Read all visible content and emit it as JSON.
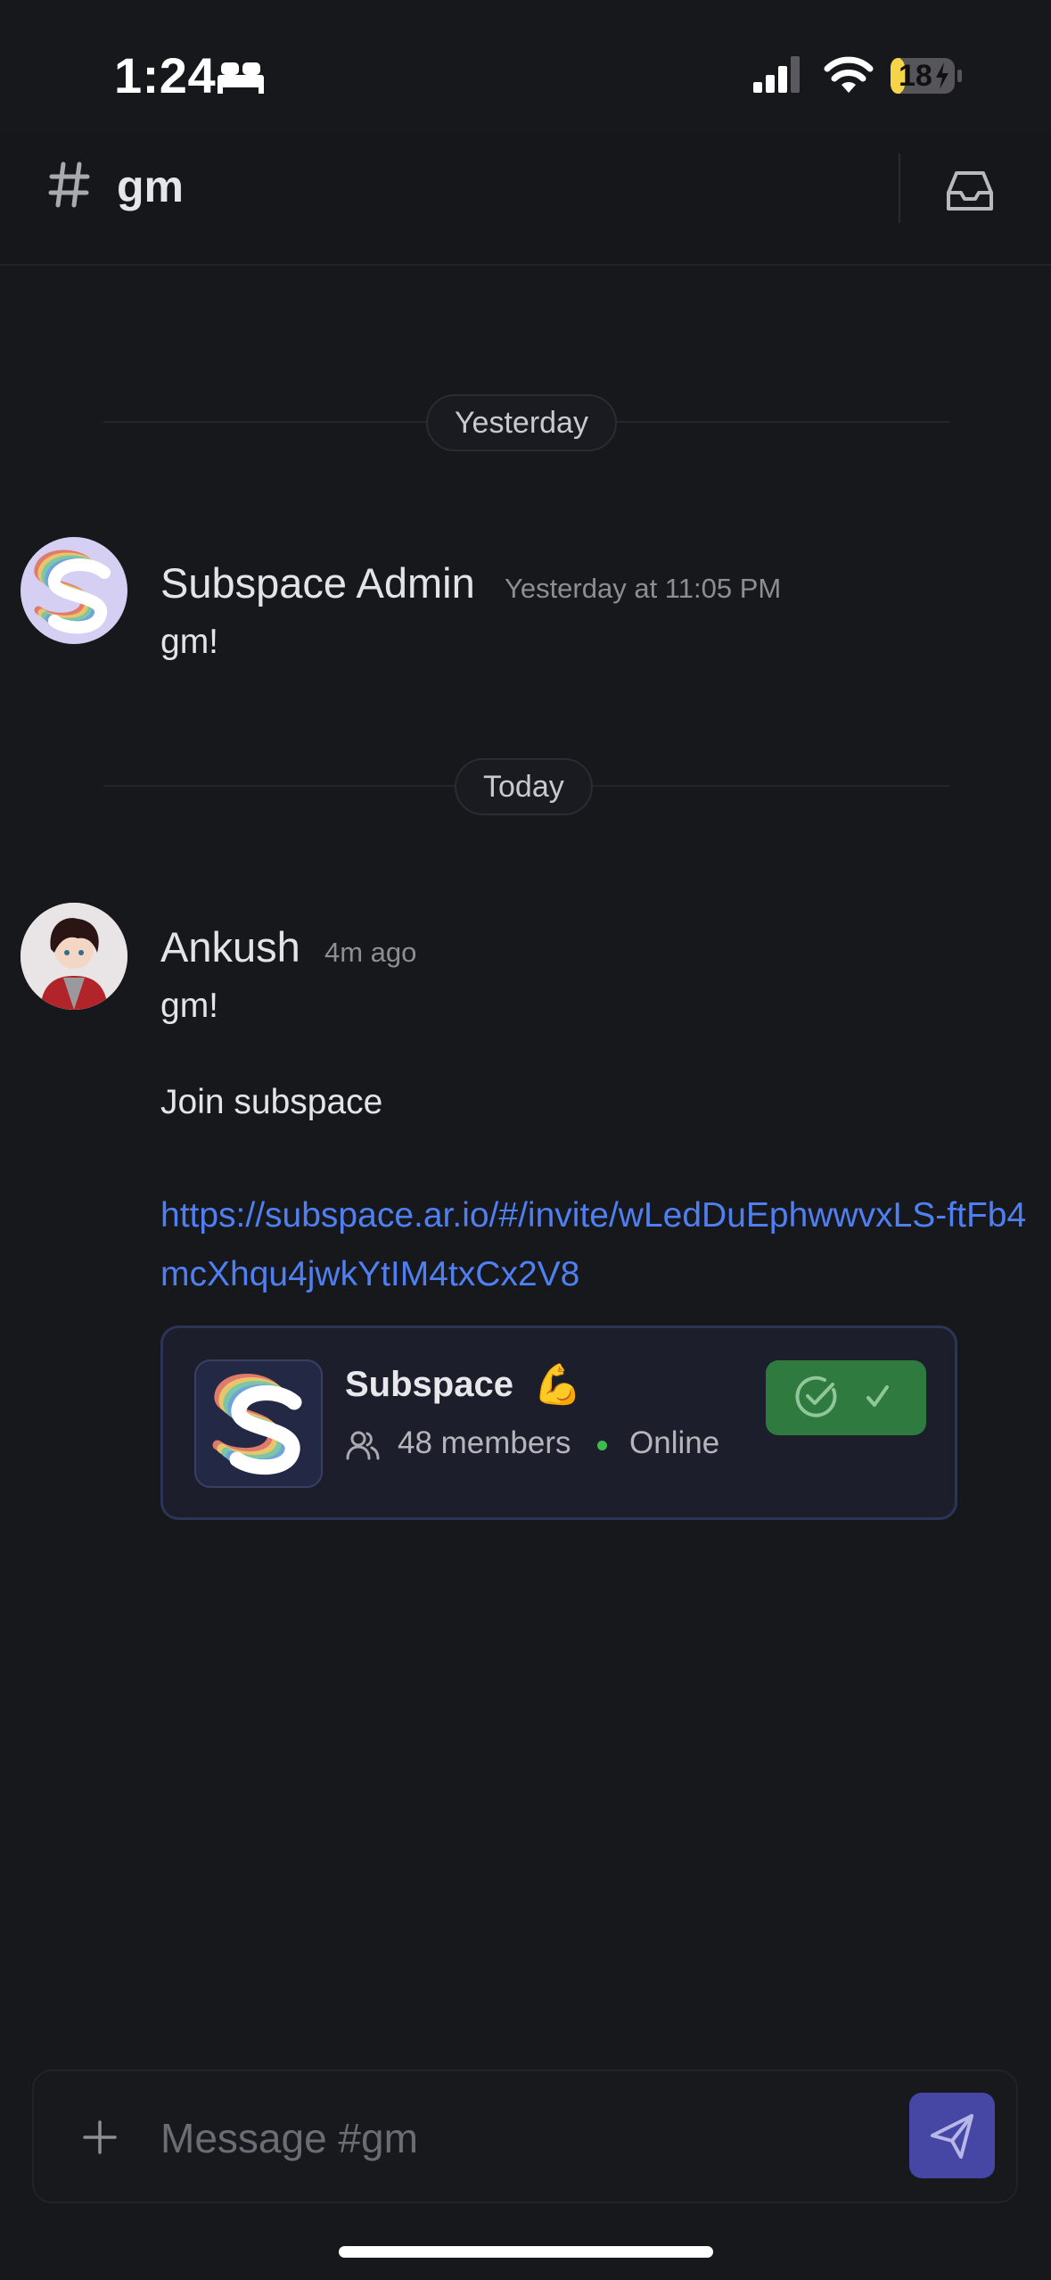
{
  "status_bar": {
    "time": "1:24",
    "battery": "18"
  },
  "channel": {
    "name": "gm"
  },
  "separators": {
    "yesterday": "Yesterday",
    "today": "Today"
  },
  "messages": [
    {
      "author": "Subspace Admin",
      "timestamp": "Yesterday at 11:05 PM",
      "lines": [
        "gm!"
      ]
    },
    {
      "author": "Ankush",
      "timestamp": "4m ago",
      "lines": [
        "gm!",
        "Join subspace"
      ],
      "link": "https://subspace.ar.io/#/invite/wLedDuEphwwvxLS-ftFb4mcXhqu4jwkYtIM4txCx2V8"
    }
  ],
  "invite_card": {
    "server_name": "Subspace",
    "server_emoji": "💪",
    "members": "48 members",
    "status": "Online"
  },
  "composer": {
    "placeholder": "Message #gm"
  },
  "colors": {
    "accent": "#4646a5",
    "link": "#4f7ff0",
    "joined": "#2f7a3e",
    "online": "#3fb950",
    "battery_low": "#f5d547"
  },
  "icons": [
    "bed-icon",
    "cell-signal-icon",
    "wifi-icon",
    "battery-icon",
    "hash-icon",
    "inbox-icon",
    "members-icon",
    "check-circle-icon",
    "checkmark-icon",
    "plus-icon",
    "send-icon"
  ]
}
